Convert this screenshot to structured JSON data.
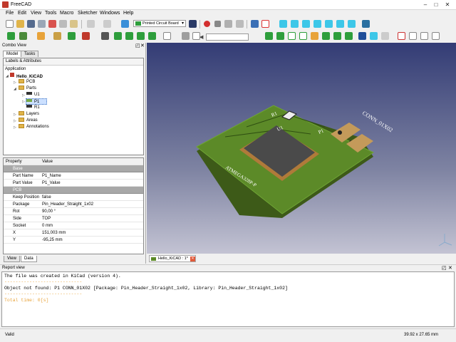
{
  "window": {
    "title": "FreeCAD",
    "minimize": "–",
    "maximize": "□",
    "close": "✕"
  },
  "menu": [
    "File",
    "Edit",
    "View",
    "Tools",
    "Macro",
    "Sketcher",
    "Windows",
    "Help"
  ],
  "toolbar": {
    "workbench": "Printed Circuit Board"
  },
  "combo": {
    "title": "Combo View",
    "tabs": [
      "Model",
      "Tasks"
    ],
    "labels_header": "Labels & Attributes",
    "tree": [
      {
        "label": "Application"
      },
      {
        "label": "Hello_KiCAD"
      },
      {
        "label": "PCB"
      },
      {
        "label": "Parts"
      },
      {
        "label": "U1"
      },
      {
        "label": "P1"
      },
      {
        "label": "R1"
      },
      {
        "label": "Layers"
      },
      {
        "label": "Areas"
      },
      {
        "label": "Annotations"
      }
    ],
    "prop_headers": {
      "property": "Property",
      "value": "Value"
    },
    "props": [
      {
        "k": "Base",
        "v": "",
        "group": true
      },
      {
        "k": "Part Name",
        "v": "P1_Name"
      },
      {
        "k": "Part Value",
        "v": "P1_Value"
      },
      {
        "k": "PCB",
        "v": "",
        "group": true
      },
      {
        "k": "Keep Position",
        "v": "false"
      },
      {
        "k": "Package",
        "v": "Pin_Header_Straight_1x02"
      },
      {
        "k": "Rot",
        "v": "90,00 °"
      },
      {
        "k": "Side",
        "v": "TOP"
      },
      {
        "k": "Socket",
        "v": "0 mm"
      },
      {
        "k": "X",
        "v": "151,003 mm"
      },
      {
        "k": "Y",
        "v": "-95,25 mm"
      }
    ],
    "bottom_tabs": [
      "View",
      "Data"
    ]
  },
  "viewport": {
    "tab": "Hello_KiCAD : 1*",
    "labels": {
      "r1": "R1",
      "u1": "U1",
      "p1": "P1",
      "conn": "CONN_01X02",
      "chip": "ATMEGA328P-P"
    }
  },
  "report": {
    "title": "Report view",
    "lines": [
      {
        "text": "The file was created in KiCad (version 4).",
        "color": "#000000"
      },
      {
        "text": "----------------------------",
        "color": "#e8a33a"
      },
      {
        "text": "Object not found: P1 CONN_01X02 [Package: Pin_Header_Straight_1x02, Library: Pin_Header_Straight_1x02]",
        "color": "#000000"
      },
      {
        "text": "----------------------------",
        "color": "#e8a33a"
      },
      {
        "text": "Total time: 0[s]",
        "color": "#e8a33a"
      }
    ]
  },
  "status": {
    "left": "Valid",
    "right": "39.92 x 27.65 mm"
  },
  "colors": {
    "accent": "#2e9e3c",
    "pcb": "#5c8a28",
    "selection": "#cce0ff"
  }
}
